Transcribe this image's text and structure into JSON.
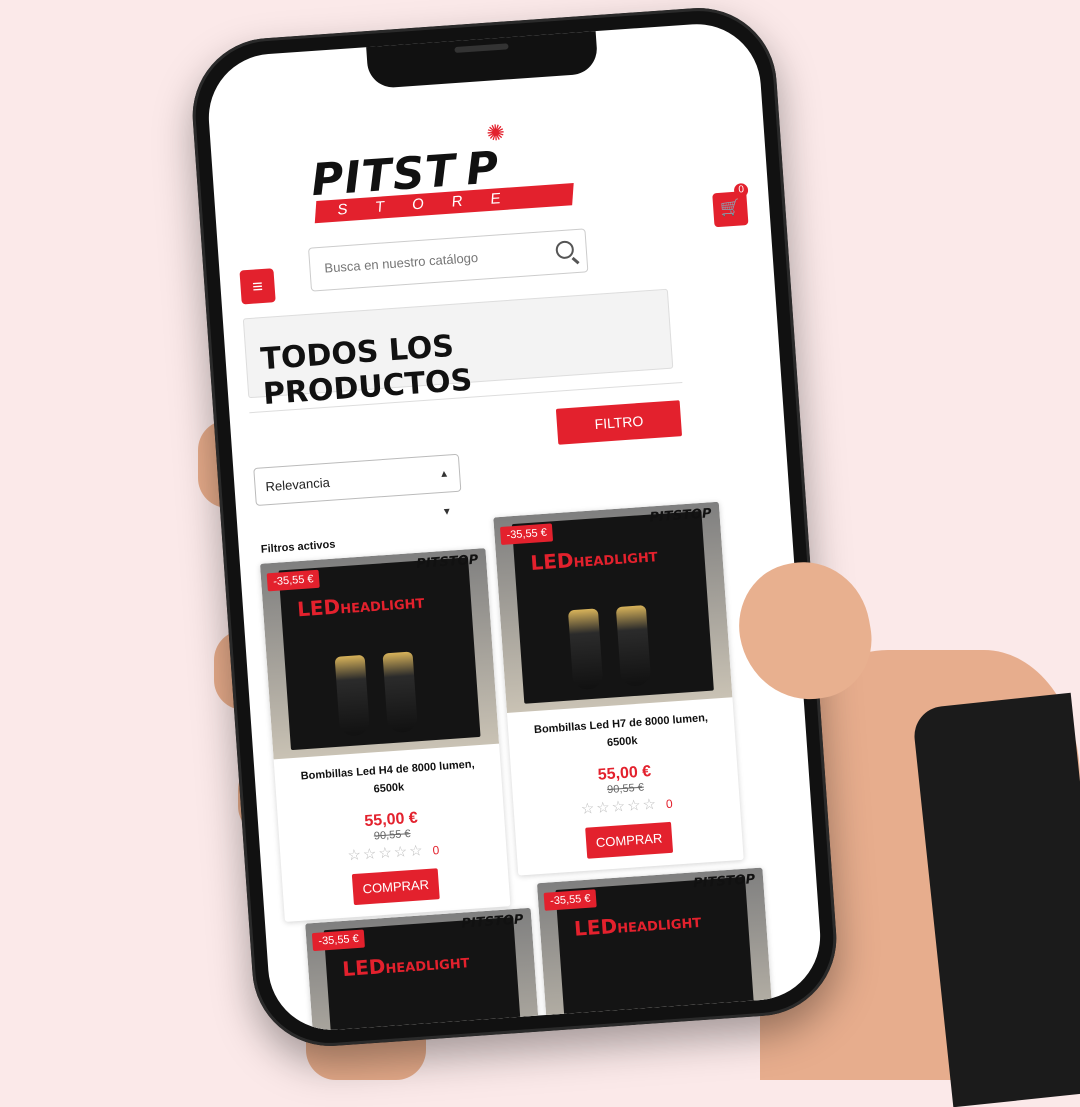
{
  "brand": {
    "logo_word": "PITST P",
    "logo_sub": "STORE"
  },
  "header": {
    "cart_count": "0",
    "search": {
      "placeholder": "Busca en nuestro catálogo"
    }
  },
  "page": {
    "title": "TODOS LOS PRODUCTOS",
    "filter_button": "FILTRO",
    "sort_selected": "Relevancia",
    "active_filters_label": "Filtros activos"
  },
  "icons": {
    "menu": "menu-icon",
    "cart": "cart-icon",
    "search": "search-icon"
  },
  "colors": {
    "accent": "#e3212d",
    "text": "#111111"
  },
  "products": [
    {
      "badge": "-35,55 €",
      "name": "Bombillas Led H4 de 8000 lumen, 6500k",
      "price": "55,00 €",
      "old_price": "90,55 €",
      "stars": "☆☆☆☆☆",
      "reviews": "0",
      "buy": "COMPRAR",
      "box_text": "LED",
      "box_text_small": "HEADLIGHT",
      "mini_logo": "PITSTOP"
    },
    {
      "badge": "-35,55 €",
      "name": "Bombillas Led H7 de 8000 lumen, 6500k",
      "price": "55,00 €",
      "old_price": "90,55 €",
      "stars": "☆☆☆☆☆",
      "reviews": "0",
      "buy": "COMPRAR",
      "box_text": "LED",
      "box_text_small": "HEADLIGHT",
      "mini_logo": "PITSTOP"
    },
    {
      "badge": "-35,55 €",
      "box_text": "LED",
      "box_text_small": "HEADLIGHT",
      "mini_logo": "PITSTOP"
    },
    {
      "badge": "-35,55 €",
      "box_text": "LED",
      "box_text_small": "HEADLIGHT",
      "mini_logo": "PITSTOP"
    }
  ]
}
